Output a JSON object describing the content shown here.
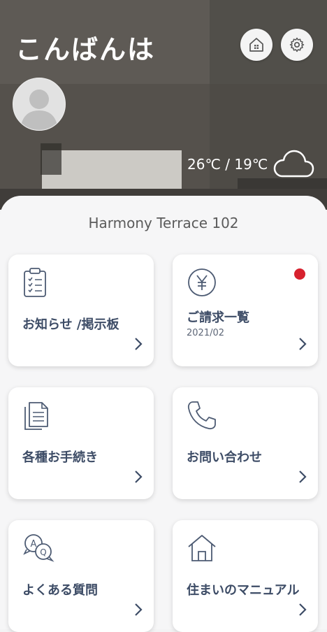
{
  "header": {
    "greeting": "こんばんは",
    "home_button_icon": "home-icon",
    "settings_button_icon": "gear-icon"
  },
  "weather": {
    "temps": "26℃ / 19℃",
    "icon": "cloud-icon"
  },
  "property_name": "Harmony Terrace 102",
  "menu": [
    {
      "label": "お知らせ /掲示板",
      "icon": "clipboard-checklist-icon"
    },
    {
      "label": "ご請求一覧",
      "sub": "2021/02",
      "icon": "yen-circle-icon",
      "has_badge": true,
      "badge_color": "#d7212e"
    },
    {
      "label": "各種お手続き",
      "icon": "documents-icon"
    },
    {
      "label": "お問い合わせ",
      "icon": "phone-icon"
    },
    {
      "label": "よくある質問",
      "icon": "faq-bubbles-icon"
    },
    {
      "label": "住まいのマニュアル",
      "icon": "house-icon"
    }
  ],
  "colors": {
    "card_text": "#3d4c66",
    "icon_stroke": "#4d5b73",
    "badge": "#d7212e"
  }
}
